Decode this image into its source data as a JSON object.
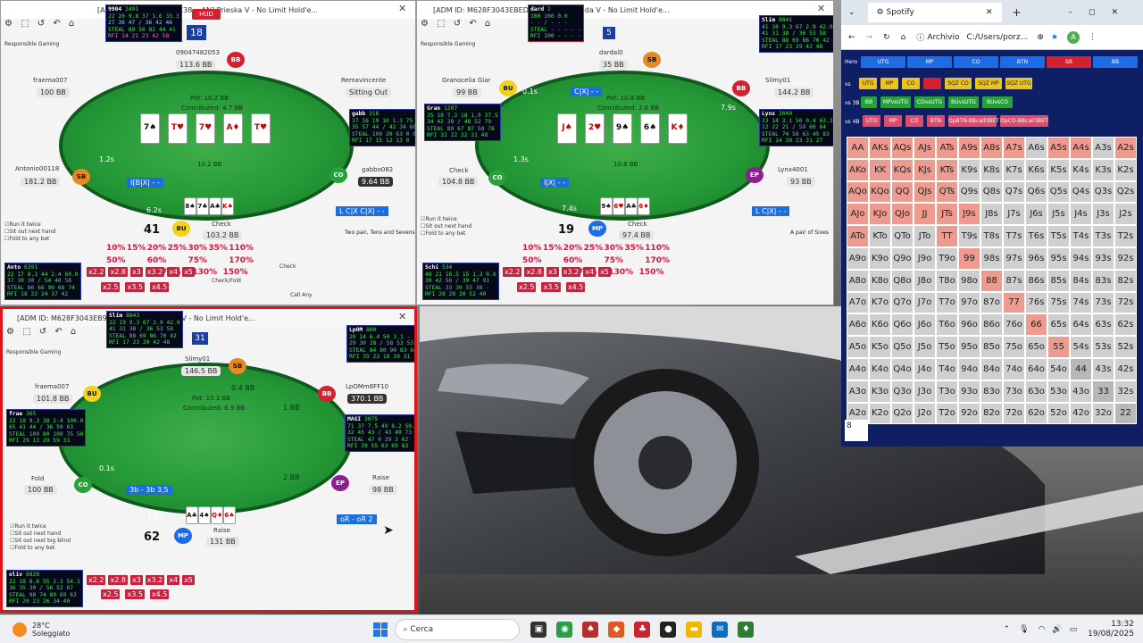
{
  "colors": {
    "felt": "#259a37",
    "hud_bg": "#06091a",
    "hud_green": "#43e243",
    "bet_red": "#c7223f",
    "range_bg": "#0f1f66",
    "range_salmon": "#ee9b8f",
    "range_grey": "#cfcfcf",
    "info_blue": "#1a6ee0"
  },
  "table1": {
    "title": "[ADM ID: M62BF3043EC38 ...AN] Prieska V - No Limit Hold'e...",
    "hud_label": "HUD",
    "responsible": "Responsible Gaming",
    "hero_hud": {
      "name": "9904",
      "hands": "2491",
      "vpip_line": "22 20 9.8 37 1.6 33.3",
      "line2": "27 36 47 / 36 42 46",
      "steal": "STEAL 89 50 82 44 41",
      "rfi": "RFI 14 21 23 42 58"
    },
    "seat_num": "18",
    "pot": "Pot: 10.2 BB",
    "contributed": "Contributed: 4.7 BB",
    "board_total": "10.2 BB",
    "board": [
      {
        "r": "7",
        "s": "♠",
        "c": "b"
      },
      {
        "r": "T",
        "s": "♥",
        "c": "r"
      },
      {
        "r": "7",
        "s": "♥",
        "c": "r"
      },
      {
        "r": "A",
        "s": "♦",
        "c": "r"
      },
      {
        "r": "T",
        "s": "♥",
        "c": "r"
      }
    ],
    "players": [
      {
        "name": "fraema007",
        "stack": "100 BB"
      },
      {
        "name": "09047482053",
        "stack": "113.6 BB",
        "pos": "BB"
      },
      {
        "name": "Remavincente",
        "stack": "Sitting Out"
      },
      {
        "name": "Antonio00118",
        "stack": "181.2 BB",
        "pos": "SB"
      },
      {
        "name": "gabbo082",
        "stack": "9.64 BB",
        "pos": "CO"
      },
      {
        "name": "Check",
        "stack": "103.2 BB",
        "pos": "BU"
      }
    ],
    "opp_hud": {
      "name": "gabb",
      "hands": "318",
      "stats": "17 16 10 10 1.3 75\n35 57 44 / 42 34 60\nSTEAL 100 20 63 0 0\nRFI 17 15 12 13 0"
    },
    "bet_left": "1.2s",
    "bet_mid": "0.9s",
    "bet_low": "6.2s",
    "info_bar": "I[B|X| - -",
    "cx_bar": "L C|X C|X| - -",
    "timer": "41",
    "hero_cards": [
      {
        "r": "8",
        "s": "♠",
        "c": "b"
      },
      {
        "r": "7",
        "s": "♣",
        "c": "b"
      },
      {
        "r": "A",
        "s": "♣",
        "c": "b"
      },
      {
        "r": "K",
        "s": "♠",
        "c": "r"
      }
    ],
    "hand_desc": "Two pair, Tens and Sevens",
    "opts": [
      "Run it twice",
      "Sit out next hand",
      "Fold to any bet"
    ],
    "pcts": [
      "10%",
      "15%",
      "20%",
      "25%",
      "30%",
      "35%",
      "110%",
      "50%",
      "60%",
      "75%",
      "170%",
      "75%",
      "130%",
      "150%"
    ],
    "bets": [
      "x2.2",
      "x2.8",
      "x3",
      "x3.2",
      "x4",
      "x5",
      "x2.5",
      "x3.5",
      "x4.5"
    ],
    "bottom_hud": {
      "name": "Anto",
      "hands": "6391",
      "stats": "22 17 8.3 44 2.4 60.0\n37 30 30 / 54 46 58\nSTEAL 86 66 90 68 74\nRFI 18 22 24 37 42"
    },
    "act_check": "Check",
    "act_checkfold": "Check/Fold",
    "act_callany": "Call Any"
  },
  "table2": {
    "title": "[ADM ID: M628F3043EBED87 ...3GC] Sumida V - No Limit Hold'e...",
    "hud_top": {
      "name": "dard",
      "hands": "2",
      "stats": "100 100 0.0\n- - / - - -\nSTEAL - - - - -\nRFI 100 - - - -"
    },
    "seat_num": "5",
    "sb_name": "dardal0",
    "sb_stack": "35 BB",
    "pot": "Pot: 10.8 BB",
    "contributed": "Contributed: 2.6 BB",
    "board_total": "10.8 BB",
    "board": [
      {
        "r": "J",
        "s": "♠",
        "c": "r"
      },
      {
        "r": "2",
        "s": "♥",
        "c": "r"
      },
      {
        "r": "9",
        "s": "♠",
        "c": "b"
      },
      {
        "r": "6",
        "s": "♠",
        "c": "b"
      },
      {
        "r": "K",
        "s": "♦",
        "c": "r"
      }
    ],
    "players": [
      {
        "name": "Granocelia Giar",
        "stack": "99 BB",
        "pos": "BU"
      },
      {
        "name": "Slimy01",
        "stack": "144.2 BB",
        "pos": "BB"
      },
      {
        "name": "Check",
        "stack": "104.8 BB",
        "pos": "CO"
      },
      {
        "name": "Lynx4001",
        "stack": "93 BB",
        "pos": "EP"
      },
      {
        "name": "Check",
        "stack": "97.4 BB",
        "pos": "MP"
      }
    ],
    "bu_hud": {
      "name": "Gran",
      "hands": "1207",
      "stats": "25 18 7.3 18 1.9 37.5\n34 42 28 / 48 52 79\nSTEAL 80 67 87 58 78\nRFI 32 22 22 31 48"
    },
    "bb_hud": {
      "name": "Slim",
      "hands": "8841",
      "stats": "41 38 9.3 67 2.9 42.0\n41 31 38 / 36 53 58\nSTEAL 88 69 86 70 42\nRFI 17 23 29 42 48"
    },
    "ep_hud": {
      "name": "Lynx",
      "hands": "2040",
      "stats": "33 14 3.1 50 0.4 63.3\n12 22 21 / 59 60 64\nSTEAL 74 58 63 45 83\nRFI 14 30 23 31 27"
    },
    "bets": [
      "0.1s",
      "1.3s",
      "7.9s",
      "7.4s"
    ],
    "info_bar": "C|X| - -",
    "ix_bar": "I|X| - -",
    "cx_bar": "L C|X| - -",
    "timer": "19",
    "hero_cards": [
      {
        "r": "9",
        "s": "♠",
        "c": "b"
      },
      {
        "r": "6",
        "s": "♥",
        "c": "r"
      },
      {
        "r": "A",
        "s": "♣",
        "c": "b"
      },
      {
        "r": "6",
        "s": "♦",
        "c": "r"
      }
    ],
    "hand_desc": "A pair of Sixes",
    "opts": [
      "Run it twice",
      "Sit out next hand",
      "Fold to any bet"
    ],
    "pcts": [
      "10%",
      "15%",
      "20%",
      "25%",
      "30%",
      "35%",
      "110%",
      "50%",
      "60%",
      "75%",
      "170%",
      "75%",
      "130%",
      "150%"
    ],
    "bets_row": [
      "x2.2",
      "x2.8",
      "x3",
      "x3.2",
      "x4",
      "x5",
      "x2.5",
      "x3.5",
      "x4.5"
    ],
    "bottom_hud": {
      "name": "Schi",
      "hands": "534",
      "stats": "48 21 16.5 15 1.3 0.0\n30 42 56 / 39 47 91\nSTEAL 33 30 55 38 -\nRFI 28 28 20 52 40"
    }
  },
  "table3": {
    "title": "[ADM ID: M628F3043EB9E9 ...6GC] Sarpedon V - No Limit Hold'e...",
    "hud_top": {
      "name": "Slim",
      "hands": "8843",
      "stats": "22 19 9.3 67 2.9 42.0\n41 31 38 / 36 53 58\nSTEAL 88 69 86 70 42\nRFI 17 23 29 42 48"
    },
    "seat_num": "31",
    "pot": "Pot: 10.3 BB",
    "contributed": "Contributed: 6.9 BB",
    "players": [
      {
        "name": "Slimy01",
        "stack": "146.5 BB",
        "pos": "SB"
      },
      {
        "name": "fraema007",
        "stack": "101.8 BB",
        "pos": "BU"
      },
      {
        "name": "LpOMm8FF10",
        "stack": "370.1 BB",
        "pos": "BB"
      },
      {
        "name": "Fold",
        "stack": "100 BB",
        "pos": "CO"
      },
      {
        "name": "Raise",
        "stack": "98 BB",
        "pos": "EP"
      },
      {
        "name": "Raise",
        "stack": "131 BB",
        "pos": "MP"
      }
    ],
    "bu_hud": {
      "name": "frae",
      "hands": "365",
      "stats": "22 18 9.3 38 2.4 100.0\n65 41 44 / 36 50 63\nSTEAL 100 80 100 75 50\nRFI 29 13 29 59 33"
    },
    "bb_hud": {
      "name": "LpOM",
      "hands": "800",
      "stats": "20 14 6.4 50 3.1 -\n29 30 28 / 58 53 53\nSTEAL 84 80 90 83 64\nRFI 35 23 18 39 31"
    },
    "ep_hud": {
      "name": "MAGI",
      "hands": "2075",
      "stats": "71 37 7.5 49 8.2 50.0\n32 45 43 / 43 49 73\nSTEAL 47 0 29 2 62\nRFI 39 55 63 69 83"
    },
    "bets": [
      "0.4 BB",
      "1 BB",
      "2 BB",
      "0.1s",
      "1.5s"
    ],
    "info_bar": "3b - 3b 3,5",
    "or_bar": "oR - oR 2",
    "timer": "62",
    "hero_cards": [
      {
        "r": "A",
        "s": "♣",
        "c": "b"
      },
      {
        "r": "4",
        "s": "♠",
        "c": "b"
      },
      {
        "r": "Q",
        "s": "♦",
        "c": "r"
      },
      {
        "r": "6",
        "s": "♠",
        "c": "r"
      }
    ],
    "opts": [
      "Run it twice",
      "Sit out next hand",
      "Sit out next big blind",
      "Fold to any bet"
    ],
    "bets_row": [
      "x2.2",
      "x2.8",
      "x3",
      "x3.2",
      "x4",
      "x5",
      "x2.5",
      "x3.5",
      "x4.5"
    ],
    "bottom_hud": {
      "name": "oliv",
      "hands": "6828",
      "stats": "22 18 8.6 55 2.3 54.3\n36 35 30 / 56 52 67\nSTEAL 98 74 89 69 63\nRFI 20 23 26 34 40"
    }
  },
  "spotify": {
    "tab_title": "Spotify",
    "addr_label": "Archivio",
    "addr_path": "C:/Users/porz...",
    "row1_label": "Hero",
    "row1": [
      "UTG",
      "MP",
      "CO",
      "BTN",
      "SB",
      "BB"
    ],
    "row2_label": "vs",
    "row2": [
      "UTG",
      "MP",
      "CO",
      "",
      "SQZ CO",
      "SQZ MP",
      "SQZ UTG"
    ],
    "row3_label": "vs 3B",
    "row3": [
      "BB",
      "MPvsUTG",
      "COvsUTG",
      "BUvsUTG",
      "BUvsCO"
    ],
    "row4_label": "vs 4B",
    "row4": [
      "UTG",
      "MP",
      "CO",
      "BTN",
      "OpBTN-BBcall3BET",
      "OpCO-BBcall3BET"
    ],
    "grid": [
      [
        "AA",
        "AKs",
        "AQs",
        "AJs",
        "ATs",
        "A9s",
        "A8s",
        "A7s",
        "A6s",
        "A5s",
        "A4s",
        "A3s",
        "A2s"
      ],
      [
        "AKo",
        "KK",
        "KQs",
        "KJs",
        "KTs",
        "K9s",
        "K8s",
        "K7s",
        "K6s",
        "K5s",
        "K4s",
        "K3s",
        "K2s"
      ],
      [
        "AQo",
        "KQo",
        "QQ",
        "QJs",
        "QTs",
        "Q9s",
        "Q8s",
        "Q7s",
        "Q6s",
        "Q5s",
        "Q4s",
        "Q3s",
        "Q2s"
      ],
      [
        "AJo",
        "KJo",
        "QJo",
        "JJ",
        "JTs",
        "J9s",
        "J8s",
        "J7s",
        "J6s",
        "J5s",
        "J4s",
        "J3s",
        "J2s"
      ],
      [
        "ATo",
        "KTo",
        "QTo",
        "JTo",
        "TT",
        "T9s",
        "T8s",
        "T7s",
        "T6s",
        "T5s",
        "T4s",
        "T3s",
        "T2s"
      ],
      [
        "A9o",
        "K9o",
        "Q9o",
        "J9o",
        "T9o",
        "99",
        "98s",
        "97s",
        "96s",
        "95s",
        "94s",
        "93s",
        "92s"
      ],
      [
        "A8o",
        "K8o",
        "Q8o",
        "J8o",
        "T8o",
        "98o",
        "88",
        "87s",
        "86s",
        "85s",
        "84s",
        "83s",
        "82s"
      ],
      [
        "A7o",
        "K7o",
        "Q7o",
        "J7o",
        "T7o",
        "97o",
        "87o",
        "77",
        "76s",
        "75s",
        "74s",
        "73s",
        "72s"
      ],
      [
        "A6o",
        "K6o",
        "Q6o",
        "J6o",
        "T6o",
        "96o",
        "86o",
        "76o",
        "66",
        "65s",
        "64s",
        "63s",
        "62s"
      ],
      [
        "A5o",
        "K5o",
        "Q5o",
        "J5o",
        "T5o",
        "95o",
        "85o",
        "75o",
        "65o",
        "55",
        "54s",
        "53s",
        "52s"
      ],
      [
        "A4o",
        "K4o",
        "Q4o",
        "J4o",
        "T4o",
        "94o",
        "84o",
        "74o",
        "64o",
        "54o",
        "44",
        "43s",
        "42s"
      ],
      [
        "A3o",
        "K3o",
        "Q3o",
        "J3o",
        "T3o",
        "93o",
        "83o",
        "73o",
        "63o",
        "53o",
        "43o",
        "33",
        "32s"
      ],
      [
        "A2o",
        "K2o",
        "Q2o",
        "J2o",
        "T2o",
        "92o",
        "82o",
        "72o",
        "62o",
        "52o",
        "42o",
        "32o",
        "22"
      ]
    ],
    "grid_state": [
      "ssssssssnssns",
      "sssssnnnnnnnn",
      "sssssnnnnnnnn",
      "ssssssnnnnnnn",
      "snnnsnnnnnnnn",
      "nnnnnsnnnnnnn",
      "nnnnnnsnnnnnn",
      "nnnnnnnsnnnnn",
      "nnnnnnnnsnnnn",
      "nnnnnnnnnsnnn",
      "nnnnnnnnnnnnn",
      "nnnnnnnnnnnnn",
      "nnnnnnnnnnnnn"
    ],
    "bottom_value": "8"
  },
  "taskbar": {
    "weather_temp": "28°C",
    "weather_desc": "Soleggiato",
    "search": "Cerca",
    "time": "13:32",
    "date": "19/08/2025"
  }
}
